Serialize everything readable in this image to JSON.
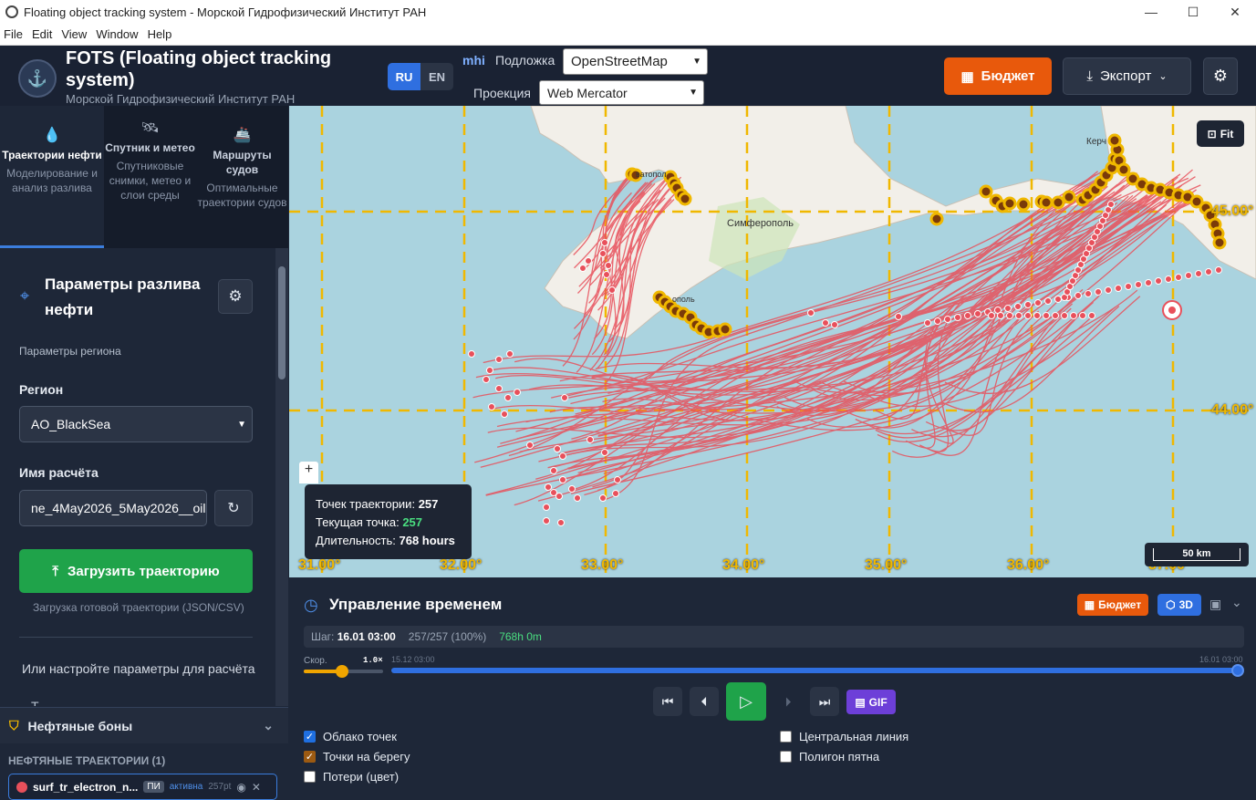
{
  "window": {
    "title": "Floating object tracking system - Морской Гидрофизический Институт РАН"
  },
  "menu": [
    "File",
    "Edit",
    "View",
    "Window",
    "Help"
  ],
  "header": {
    "title": "FOTS (Floating object tracking system)",
    "subtitle": "Морской Гидрофизический Институт РАН",
    "lang_ru": "RU",
    "lang_en": "EN",
    "mhi": "mhi",
    "basemap_label": "Подложка",
    "basemap_value": "OpenStreetMap",
    "projection_label": "Проекция",
    "projection_value": "Web Mercator",
    "budget": "Бюджет",
    "export": "Экспорт"
  },
  "tabs": [
    {
      "title": "Траектории нефти",
      "desc": "Моделирование и анализ разлива"
    },
    {
      "title": "Спутник и метео",
      "desc": "Спутниковые снимки, метео и слои среды"
    },
    {
      "title": "Маршруты судов",
      "desc": "Оптимальные траектории судов"
    }
  ],
  "panel": {
    "title": "Параметры разлива нефти",
    "region_params": "Параметры региона",
    "region_label": "Регион",
    "region_value": "AO_BlackSea",
    "calc_label": "Имя расчёта",
    "calc_value": "ne_4May2026_5May2026__oil",
    "upload_button": "Загрузить траекторию",
    "upload_hint": "Загрузка готовой траектории (JSON/CSV)",
    "or_configure": "Или настройте параметры для расчёта",
    "cut": "Т"
  },
  "booms": "Нефтяные боны",
  "trajectories": {
    "header": "НЕФТЯНЫЕ ТРАЕКТОРИИ (1)",
    "item_name": "surf_tr_electron_n...",
    "item_badge": "ПИ",
    "item_status": "активна",
    "item_points": "257pt"
  },
  "map": {
    "city": "Симферополь",
    "city_kerch": "Керч",
    "city_sev": "ватопол",
    "city_yalta": "ополь",
    "fit": "Fit",
    "scale": "50 km",
    "lon_ticks": [
      "31.00°",
      "32.00°",
      "33.00°",
      "34.00°",
      "35.00°",
      "36.00°",
      "37.00°"
    ],
    "lat_ticks": [
      "45.00°",
      "44.00°"
    ],
    "tooltip": {
      "points_label": "Точек траектории:",
      "points_value": "257",
      "current_label": "Текущая точка:",
      "current_value": "257",
      "duration_label": "Длительность:",
      "duration_value": "768 hours"
    },
    "colors": {
      "sea": "#aad3df",
      "land": "#f2efe9",
      "track": "#e8505b",
      "shore": "#f0b800"
    }
  },
  "time": {
    "title": "Управление временем",
    "budget": "Бюджет",
    "three_d": "3D",
    "step_label": "Шаг:",
    "step_value": "16.01 03:00",
    "progress": "257/257 (100%)",
    "elapsed": "768h 0m",
    "speed_label": "Скор.",
    "speed_value": "1.0×",
    "start": "15.12 03:00",
    "end": "16.01 03:00",
    "gif": "GIF"
  },
  "checks": [
    {
      "label": "Облако точек",
      "checked": true
    },
    {
      "label": "Точки на берегу",
      "checked": true
    },
    {
      "label": "Потери (цвет)",
      "checked": false
    },
    {
      "label": "Центральная линия",
      "checked": false
    },
    {
      "label": "Полигон пятна",
      "checked": false
    }
  ]
}
